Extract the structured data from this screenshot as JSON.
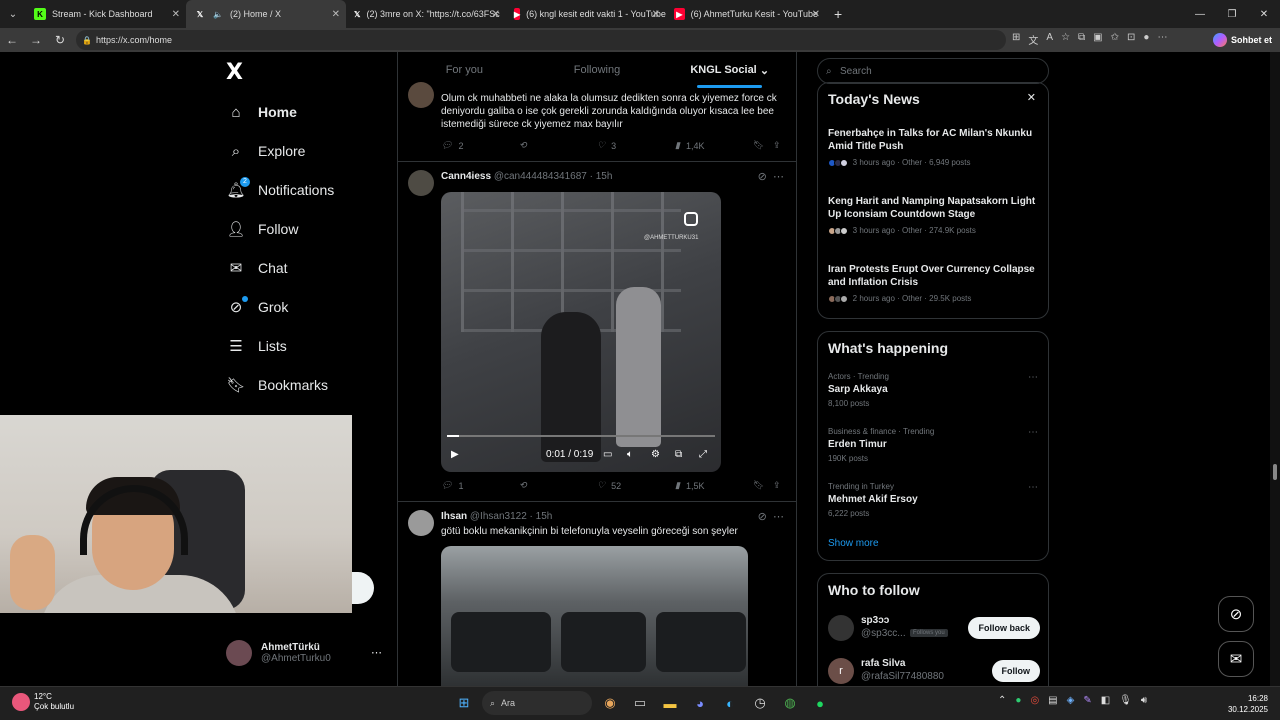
{
  "browser": {
    "tabs": [
      {
        "title": "Stream - Kick Dashboard",
        "icon": "kick-icon",
        "color": "#53fc18"
      },
      {
        "title": "(2) Home / X",
        "icon": "x-icon",
        "color": "#ffffff"
      },
      {
        "title": "(2) 3mre on X: \"https://t.co/63FSc",
        "icon": "x-icon",
        "color": "#ffffff"
      },
      {
        "title": "(6) kngl kesit edit vakti 1 - YouTube",
        "icon": "youtube-icon",
        "color": "#ff0033"
      },
      {
        "title": "(6) AhmetTurku Kesit - YouTube",
        "icon": "youtube-icon",
        "color": "#ff0033"
      }
    ],
    "url": "https://x.com/home",
    "copilot_label": "Sohbet et"
  },
  "sidebar": {
    "logo": "X",
    "items": [
      {
        "label": "Home",
        "icon": "home-icon"
      },
      {
        "label": "Explore",
        "icon": "search-icon"
      },
      {
        "label": "Notifications",
        "icon": "bell-icon",
        "badge": "2"
      },
      {
        "label": "Follow",
        "icon": "add-user-icon"
      },
      {
        "label": "Chat",
        "icon": "mail-icon"
      },
      {
        "label": "Grok",
        "icon": "grok-icon"
      },
      {
        "label": "Lists",
        "icon": "lists-icon"
      },
      {
        "label": "Bookmarks",
        "icon": "bookmark-icon"
      }
    ],
    "account": {
      "name": "AhmetTürkü",
      "handle": "@AhmetTurku0"
    }
  },
  "feed": {
    "tabs": [
      "For you",
      "Following",
      "KNGL Social"
    ],
    "tweets": [
      {
        "text": "Olum ck muhabbeti ne alaka la olumsuz dedikten sonra ck yiyemez force ck deniyordu galiba o ise çok gerekli zorunda kaldığında oluyor kısaca lee bee istemediği sürece ck yiyemez max bayılır",
        "replies": "2",
        "retweets": "",
        "likes": "3",
        "views": "1,4K"
      },
      {
        "name": "Cann4iess",
        "handle": "@can444484341687",
        "time": "15h",
        "replies": "1",
        "retweets": "",
        "likes": "52",
        "views": "1,5K",
        "video_time": "0:01 / 0:19",
        "watermark": "@AHMETTURKU31"
      },
      {
        "name": "Ihsan",
        "handle": "@Ihsan3122",
        "time": "15h",
        "text": "götü boklu mekanikçinin bi telefonuyla veyselin göreceği son şeyler"
      }
    ]
  },
  "right": {
    "search_placeholder": "Search",
    "news": {
      "title": "Today's News",
      "items": [
        {
          "title": "Fenerbahçe in Talks for AC Milan's Nkunku Amid Title Push",
          "meta": "3 hours ago · Other · 6,949 posts"
        },
        {
          "title": "Keng Harit and Namping Napatsakorn Light Up Iconsiam Countdown Stage",
          "meta": "3 hours ago · Other · 274.9K posts"
        },
        {
          "title": "Iran Protests Erupt Over Currency Collapse and Inflation Crisis",
          "meta": "2 hours ago · Other · 29.5K posts"
        }
      ]
    },
    "happening": {
      "title": "What's happening",
      "items": [
        {
          "context": "Actors · Trending",
          "name": "Sarp Akkaya",
          "posts": "8,100 posts"
        },
        {
          "context": "Business & finance · Trending",
          "name": "Erden Timur",
          "posts": "190K posts"
        },
        {
          "context": "Trending in Turkey",
          "name": "Mehmet Akif Ersoy",
          "posts": "6,222 posts"
        }
      ],
      "show_more": "Show more"
    },
    "who_to_follow": {
      "title": "Who to follow",
      "users": [
        {
          "name": "sp3ɔɔ",
          "handle": "@sp3cc...",
          "follows_you": "Follows you",
          "button": "Follow back"
        },
        {
          "name": "rafa Silva",
          "handle": "@rafaSil77480880",
          "button": "Follow",
          "avatar_letter": "r"
        }
      ]
    }
  },
  "taskbar": {
    "weather_temp": "12°C",
    "weather_text": "Çok bulutlu",
    "search_label": "Ara",
    "time": "16:28",
    "date": "30.12.2025"
  }
}
